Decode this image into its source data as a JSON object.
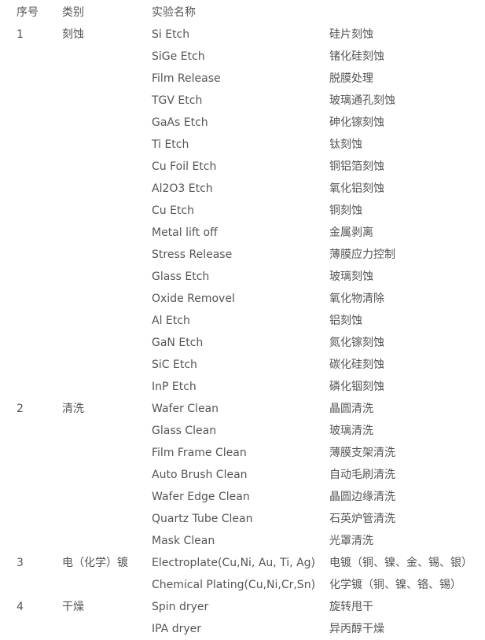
{
  "header": {
    "no": "序号",
    "category": "类别",
    "name": "实验名称",
    "name_zh": ""
  },
  "groups": [
    {
      "no": "1",
      "category": "刻蚀",
      "items": [
        {
          "en": "Si Etch",
          "zh": "硅片刻蚀"
        },
        {
          "en": "SiGe Etch",
          "zh": "锗化硅刻蚀"
        },
        {
          "en": "Film Release",
          "zh": "脱膜处理"
        },
        {
          "en": "TGV Etch",
          "zh": "玻璃通孔刻蚀"
        },
        {
          "en": "GaAs Etch",
          "zh": "砷化镓刻蚀"
        },
        {
          "en": "Ti Etch",
          "zh": "钛刻蚀"
        },
        {
          "en": "Cu Foil Etch",
          "zh": "铜铝箔刻蚀"
        },
        {
          "en": "Al2O3 Etch",
          "zh": "氧化铝刻蚀"
        },
        {
          "en": "Cu Etch",
          "zh": "铜刻蚀"
        },
        {
          "en": "Metal lift off",
          "zh": "金属剥离"
        },
        {
          "en": "Stress Release",
          "zh": "薄膜应力控制"
        },
        {
          "en": "Glass Etch",
          "zh": "玻璃刻蚀"
        },
        {
          "en": "Oxide Removel",
          "zh": "氧化物清除"
        },
        {
          "en": "Al Etch",
          "zh": "铝刻蚀"
        },
        {
          "en": "GaN Etch",
          "zh": "氮化镓刻蚀"
        },
        {
          "en": "SiC Etch",
          "zh": "碳化硅刻蚀"
        },
        {
          "en": "InP Etch",
          "zh": "磷化铟刻蚀"
        }
      ]
    },
    {
      "no": "2",
      "category": "清洗",
      "items": [
        {
          "en": "Wafer Clean",
          "zh": "晶圆清洗"
        },
        {
          "en": "Glass Clean",
          "zh": "玻璃清洗"
        },
        {
          "en": "Film Frame Clean",
          "zh": "薄膜支架清洗"
        },
        {
          "en": "Auto Brush Clean",
          "zh": "自动毛刷清洗"
        },
        {
          "en": "Wafer Edge Clean",
          "zh": "晶圆边缘清洗"
        },
        {
          "en": "Quartz Tube Clean",
          "zh": "石英炉管清洗"
        },
        {
          "en": "Mask Clean",
          "zh": "光罩清洗"
        }
      ]
    },
    {
      "no": "3",
      "category": "电（化学）镀",
      "items": [
        {
          "en": "Electroplate(Cu,Ni, Au, Ti, Ag)",
          "zh": "电镀（铜、镍、金、锡、银）"
        },
        {
          "en": "Chemical Plating(Cu,Ni,Cr,Sn)",
          "zh": "化学镀（铜、镍、铬、锡）"
        }
      ]
    },
    {
      "no": "4",
      "category": "干燥",
      "items": [
        {
          "en": "Spin dryer",
          "zh": "旋转甩干"
        },
        {
          "en": "IPA dryer",
          "zh": "异丙醇干燥"
        }
      ]
    }
  ]
}
